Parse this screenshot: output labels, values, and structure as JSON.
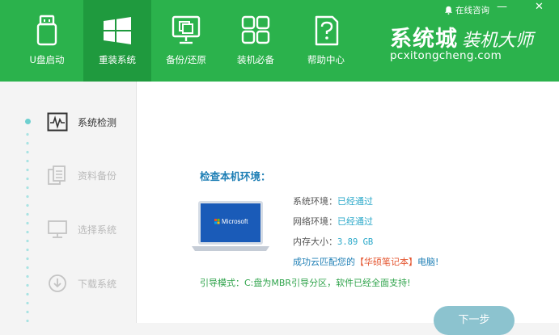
{
  "topbar": {
    "nav_items": [
      {
        "label": "U盘启动",
        "icon": "usb-drive-icon"
      },
      {
        "label": "重装系统",
        "icon": "windows-logo-icon"
      },
      {
        "label": "备份/还原",
        "icon": "backup-copy-icon"
      },
      {
        "label": "装机必备",
        "icon": "app-grid-icon"
      },
      {
        "label": "帮助中心",
        "icon": "help-document-icon"
      }
    ],
    "active_index": 1,
    "brand_title": "系统城",
    "brand_sub": "装机大师",
    "brand_url": "pcxitongcheng.com",
    "consult_label": "在线咨询",
    "minimize_glyph": "—",
    "close_glyph": "✕"
  },
  "sidebar": {
    "steps": [
      {
        "label": "系统检测",
        "icon": "monitor-pulse-icon",
        "state": "active"
      },
      {
        "label": "资料备份",
        "icon": "documents-icon",
        "state": "inactive"
      },
      {
        "label": "选择系统",
        "icon": "computer-icon",
        "state": "inactive"
      },
      {
        "label": "下载系统",
        "icon": "download-icon",
        "state": "inactive"
      }
    ]
  },
  "main": {
    "env_title": "检查本机环境：",
    "laptop_screen_text": "Microsoft",
    "rows": [
      {
        "label": "系统环境：",
        "value": "已经通过"
      },
      {
        "label": "网络环境：",
        "value": "已经通过"
      },
      {
        "label": "内存大小：",
        "value": "3.89 GB"
      }
    ],
    "success_prefix": "成功云匹配您的",
    "success_brand": "【华硕笔记本】",
    "success_suffix": "电脑!",
    "boot_text": "引导模式：C:盘为MBR引导分区，软件已经全面支持!",
    "next_button": "下一步"
  },
  "colors": {
    "topbar_green": "#2bb24c",
    "active_tab_green": "#1f9a3e",
    "accent_blue": "#1f7fb5",
    "value_cyan": "#29a8c9",
    "boot_green": "#2ea34a",
    "brand_red": "#e4552f",
    "button": "#8cc3cf"
  }
}
